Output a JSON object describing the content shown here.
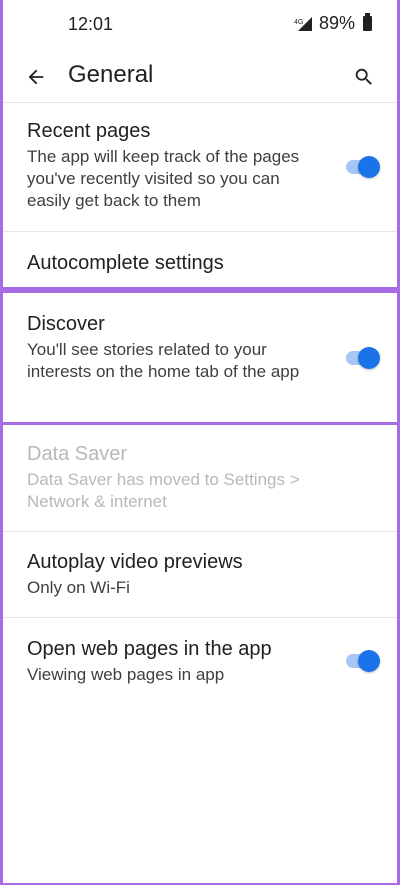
{
  "status_bar": {
    "time": "12:01",
    "battery": "89%",
    "network_label": "4G"
  },
  "app_bar": {
    "title": "General",
    "back_icon": "arrow-left-icon",
    "search_icon": "search-icon"
  },
  "settings": [
    {
      "title": "Recent pages",
      "summary": "The app will keep track of the pages you've recently visited so you can easily get back to them",
      "toggle_on": true
    },
    {
      "title": "Autocomplete settings"
    },
    {
      "title": "Discover",
      "summary": "You'll see stories related to your interests on the home tab of the app",
      "toggle_on": true
    },
    {
      "title": "Data Saver",
      "summary": "Data Saver has moved to Settings > Network & internet",
      "disabled": true
    },
    {
      "title": "Autoplay video previews",
      "summary": "Only on Wi-Fi"
    },
    {
      "title": "Open web pages in the app",
      "summary": "Viewing web pages in app",
      "toggle_on": true
    }
  ],
  "colors": {
    "accent": "#1a73e8",
    "highlight_frame": "#a86be6"
  }
}
